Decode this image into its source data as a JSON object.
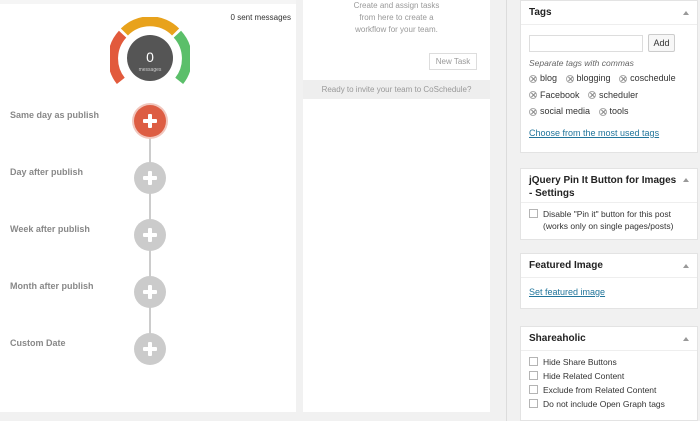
{
  "social": {
    "sent_messages": "0 sent messages",
    "gauge": {
      "count": "0",
      "unit": "messages",
      "colors": [
        "#e25a3c",
        "#e8a21c",
        "#5bbf6a"
      ]
    },
    "steps": [
      {
        "label": "Same day as publish",
        "active": true
      },
      {
        "label": "Day after publish",
        "active": false
      },
      {
        "label": "Week after publish",
        "active": false
      },
      {
        "label": "Month after publish",
        "active": false
      },
      {
        "label": "Custom Date",
        "active": false
      }
    ]
  },
  "tasks": {
    "description": [
      "Create and assign tasks",
      "from here to create a",
      "workflow for your team."
    ],
    "new_task_label": "New Task",
    "invite_text": "Ready to invite your team to CoSchedule?"
  },
  "sidebar": {
    "tags": {
      "title": "Tags",
      "add_label": "Add",
      "hint": "Separate tags with commas",
      "items": [
        "blog",
        "blogging",
        "coschedule",
        "Facebook",
        "scheduler",
        "social media",
        "tools"
      ],
      "most_used_link": "Choose from the most used tags"
    },
    "pin": {
      "title": "jQuery Pin It Button for Images - Settings",
      "checkbox_label": "Disable \"Pin it\" button for this post (works only on single pages/posts)"
    },
    "featured": {
      "title": "Featured Image",
      "link": "Set featured image"
    },
    "shareaholic": {
      "title": "Shareaholic",
      "options": [
        "Hide Share Buttons",
        "Hide Related Content",
        "Exclude from Related Content",
        "Do not include Open Graph tags"
      ]
    }
  }
}
